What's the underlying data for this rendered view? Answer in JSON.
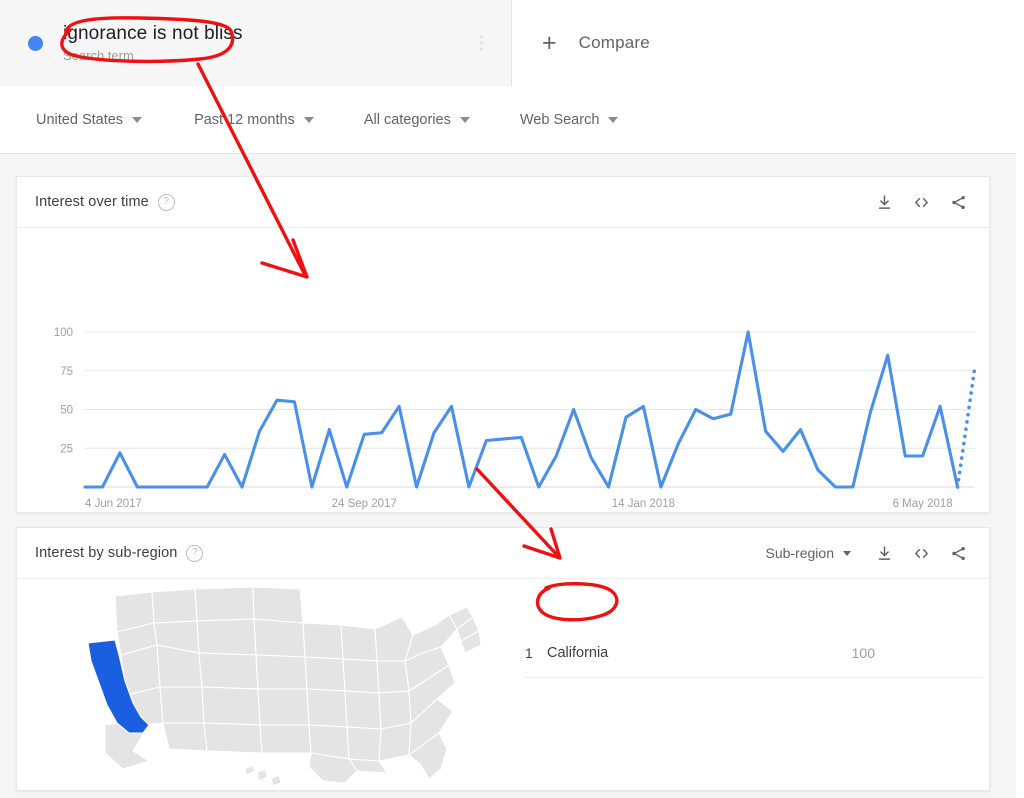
{
  "search_term": {
    "label": "ignorance is not bliss",
    "sublabel": "Search term",
    "dot_color": "#4285f4",
    "menu_icon": "more-vert-icon"
  },
  "compare": {
    "label": "Compare",
    "plus_icon": "plus-icon"
  },
  "filters": [
    {
      "label": "United States",
      "icon": "chevron-down-icon"
    },
    {
      "label": "Past 12 months",
      "icon": "chevron-down-icon"
    },
    {
      "label": "All categories",
      "icon": "chevron-down-icon"
    },
    {
      "label": "Web Search",
      "icon": "chevron-down-icon"
    }
  ],
  "interest_over_time": {
    "title": "Interest over time",
    "help_icon": "help-circle-icon",
    "actions": [
      {
        "name": "download-icon",
        "label": "Download"
      },
      {
        "name": "embed-icon",
        "label": "Embed"
      },
      {
        "name": "share-icon",
        "label": "Share"
      }
    ]
  },
  "interest_by_subregion": {
    "title": "Interest by sub-region",
    "help_icon": "help-circle-icon",
    "select_label": "Sub-region",
    "select_icon": "chevron-down-icon",
    "actions": [
      {
        "name": "download-icon",
        "label": "Download"
      },
      {
        "name": "embed-icon",
        "label": "Embed"
      },
      {
        "name": "share-icon",
        "label": "Share"
      }
    ],
    "rows": [
      {
        "rank": "1",
        "name": "California",
        "value": "100",
        "percent": 100
      }
    ],
    "map": {
      "highlighted_region": "California",
      "highlight_color": "#1a5fe0",
      "base_color": "#e4e4e4"
    }
  },
  "chart_data": {
    "type": "line",
    "title": "Interest over time",
    "xlabel": "",
    "ylabel": "",
    "ylim": [
      0,
      100
    ],
    "yticks": [
      25,
      50,
      75,
      100
    ],
    "grid": true,
    "legend": false,
    "line_color": "#4a90e8",
    "tick_labels": [
      "4 Jun 2017",
      "24 Sep 2017",
      "14 Jan 2018",
      "6 May 2018"
    ],
    "tick_positions": [
      0,
      16,
      32,
      48
    ],
    "partial_data_dotted_tail": true,
    "values": [
      0,
      0,
      22,
      0,
      0,
      0,
      0,
      0,
      21,
      0,
      36,
      56,
      55,
      0,
      37,
      0,
      34,
      35,
      52,
      0,
      35,
      52,
      0,
      30,
      31,
      32,
      0,
      20,
      50,
      19,
      0,
      45,
      52,
      0,
      28,
      50,
      44,
      47,
      100,
      36,
      23,
      37,
      11,
      0,
      0,
      48,
      85,
      20,
      20,
      52,
      0,
      78
    ]
  },
  "annotations": [
    {
      "name": "term-circle",
      "type": "ellipse",
      "color": "#ee1111"
    },
    {
      "name": "arrow-to-chart",
      "type": "arrow",
      "color": "#ee1111"
    },
    {
      "name": "arrow-to-california",
      "type": "arrow",
      "color": "#ee1111"
    },
    {
      "name": "california-circle",
      "type": "ellipse",
      "color": "#ee1111"
    }
  ]
}
